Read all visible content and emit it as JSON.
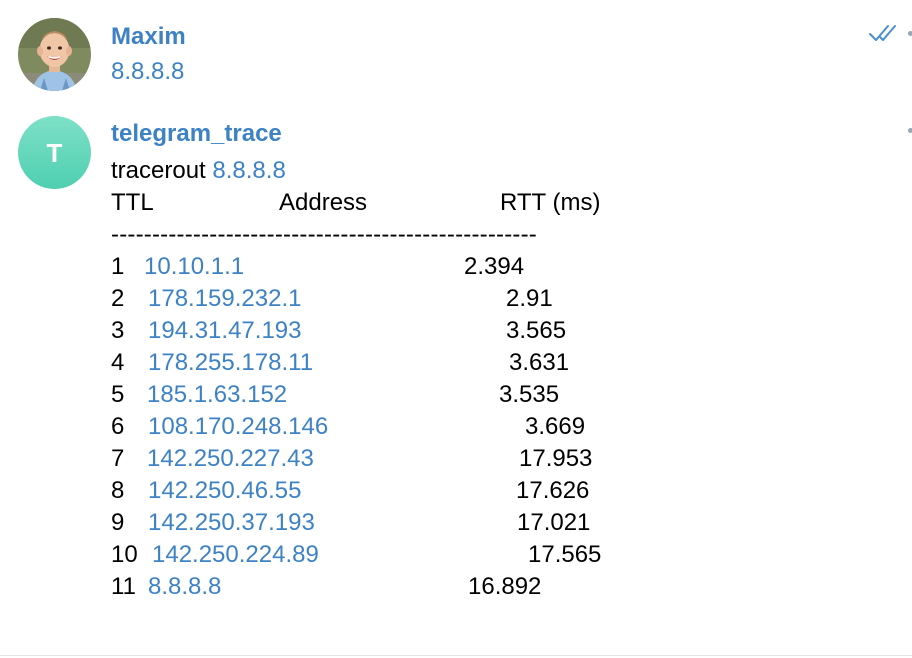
{
  "messages": [
    {
      "sender": "Maxim",
      "text": "8.8.8.8",
      "status": "read"
    },
    {
      "sender": "telegram_trace",
      "avatar_initial": "T",
      "command_prefix": "tracerout",
      "command_target": "8.8.8.8",
      "headers": {
        "ttl": "TTL",
        "address": "Address",
        "rtt": "RTT (ms)"
      },
      "separator": "----------------------------------------------------",
      "hops": [
        {
          "ttl": "1",
          "address": "10.10.1.1",
          "rtt": "2.394"
        },
        {
          "ttl": "2",
          "address": "178.159.232.1",
          "rtt": "2.91"
        },
        {
          "ttl": "3",
          "address": "194.31.47.193",
          "rtt": "3.565"
        },
        {
          "ttl": "4",
          "address": "178.255.178.11",
          "rtt": "3.631"
        },
        {
          "ttl": "5",
          "address": "185.1.63.152",
          "rtt": "3.535"
        },
        {
          "ttl": "6",
          "address": "108.170.248.146",
          "rtt": "3.669"
        },
        {
          "ttl": "7",
          "address": "142.250.227.43",
          "rtt": "17.953"
        },
        {
          "ttl": "8",
          "address": "142.250.46.55",
          "rtt": "17.626"
        },
        {
          "ttl": "9",
          "address": "142.250.37.193",
          "rtt": "17.021"
        },
        {
          "ttl": "10",
          "address": "142.250.224.89",
          "rtt": "17.565"
        },
        {
          "ttl": "11",
          "address": "8.8.8.8",
          "rtt": "16.892"
        }
      ]
    }
  ],
  "colors": {
    "link": "#3d82c4",
    "avatar_bot": "#5fd6b9",
    "read_ticks": "#4a8fd0"
  },
  "icons": {
    "read_status": "double-check-icon",
    "maxim_avatar": "user-photo-avatar"
  }
}
